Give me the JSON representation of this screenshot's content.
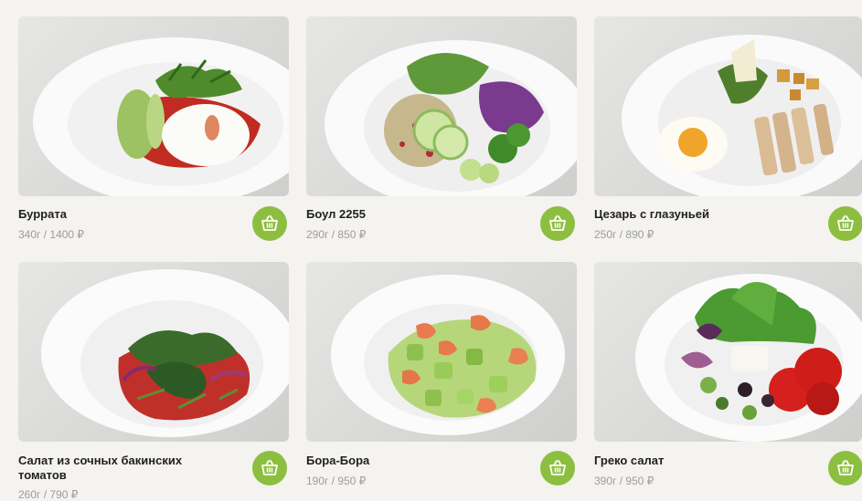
{
  "products": [
    {
      "name": "Буррата",
      "meta": "340г / 1400 ₽"
    },
    {
      "name": "Боул 2255",
      "meta": "290г / 850 ₽"
    },
    {
      "name": "Цезарь с глазуньей",
      "meta": "250г / 890 ₽"
    },
    {
      "name": "Салат из сочных бакинских\nтоматов",
      "meta": "260г / 790 ₽"
    },
    {
      "name": "Бора-Бора",
      "meta": "190г / 950 ₽"
    },
    {
      "name": "Греко салат",
      "meta": "390г / 950 ₽"
    }
  ],
  "colors": {
    "accent": "#8cbf3f",
    "background": "#f4f3ef",
    "price": "#9c9c9c"
  },
  "icons": {
    "cart": "basket-icon"
  }
}
